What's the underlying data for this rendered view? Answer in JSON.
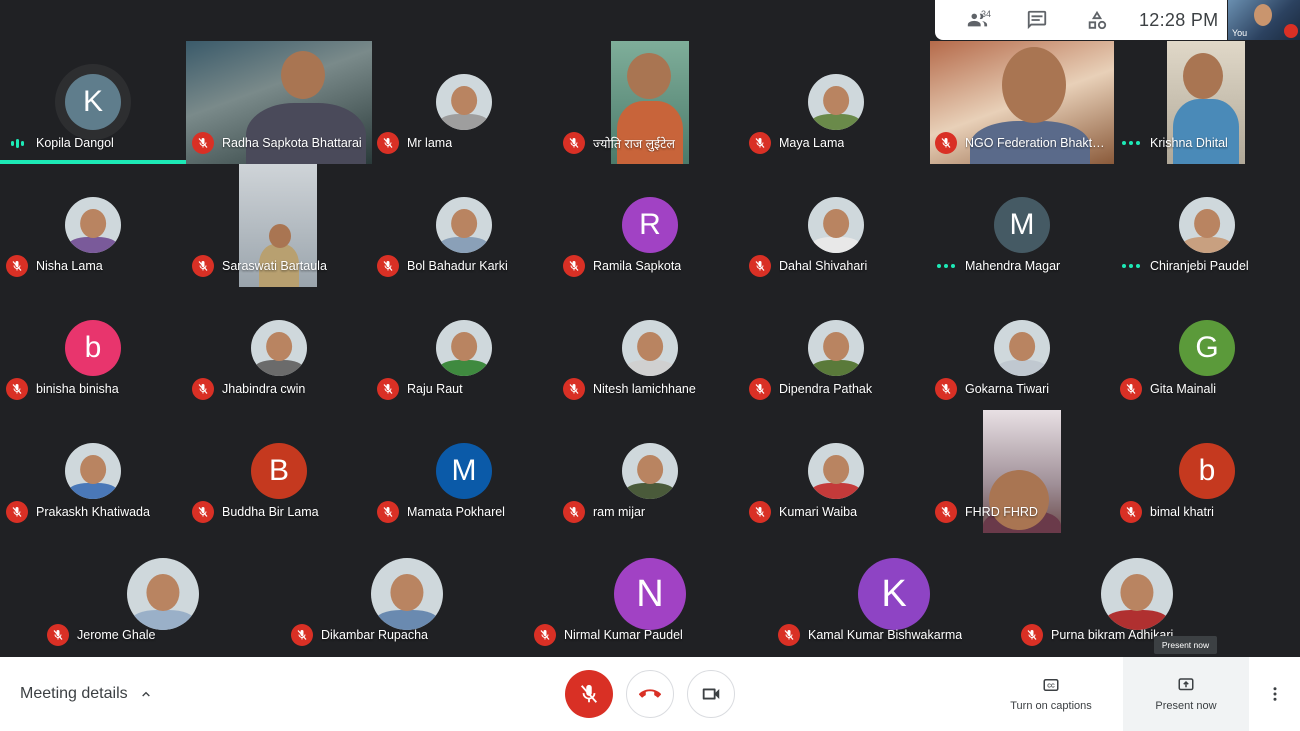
{
  "topbar": {
    "participants_count": "34",
    "time": "12:28 PM",
    "self_label": "You"
  },
  "rows": [
    [
      {
        "name": "Kopila Dangol",
        "kind": "letter",
        "letter": "K",
        "color": "#5f7d8c",
        "status": "speaking",
        "active": true
      },
      {
        "name": "Radha Sapkota Bhattarai",
        "kind": "video",
        "status": "muted"
      },
      {
        "name": "Mr lama",
        "kind": "photo",
        "color": "#9e9e9e",
        "status": "muted"
      },
      {
        "name": "ज्योति राज लुईटेल",
        "kind": "video",
        "status": "muted"
      },
      {
        "name": "Maya Lama",
        "kind": "photo",
        "color": "#6a8a4a",
        "status": "muted"
      },
      {
        "name": "NGO Federation Bhaktapur",
        "kind": "video",
        "status": "muted"
      },
      {
        "name": "Krishna Dhital",
        "kind": "video",
        "status": "dots"
      }
    ],
    [
      {
        "name": "Nisha Lama",
        "kind": "photo",
        "color": "#7a5a9a",
        "status": "muted"
      },
      {
        "name": "Saraswati Bartaula",
        "kind": "video",
        "status": "muted"
      },
      {
        "name": "Bol Bahadur Karki",
        "kind": "photo",
        "color": "#8aa0b8",
        "status": "muted"
      },
      {
        "name": "Ramila Sapkota",
        "kind": "letter",
        "letter": "R",
        "color": "#a142c4",
        "status": "muted"
      },
      {
        "name": "Dahal Shivahari",
        "kind": "photo",
        "color": "#e8e8e8",
        "status": "muted"
      },
      {
        "name": "Mahendra Magar",
        "kind": "letter",
        "letter": "M",
        "color": "#455a64",
        "status": "dots"
      },
      {
        "name": "Chiranjebi Paudel",
        "kind": "photo",
        "color": "#c8a080",
        "status": "dots"
      }
    ],
    [
      {
        "name": "binisha binisha",
        "kind": "letter",
        "letter": "b",
        "color": "#e8356d",
        "status": "muted"
      },
      {
        "name": "Jhabindra cwin",
        "kind": "photo",
        "color": "#6b6b6b",
        "status": "muted"
      },
      {
        "name": "Raju Raut",
        "kind": "photo",
        "color": "#3f8a3f",
        "status": "muted"
      },
      {
        "name": "Nitesh lamichhane",
        "kind": "photo",
        "color": "#d0d0d0",
        "status": "muted"
      },
      {
        "name": "Dipendra Pathak",
        "kind": "photo",
        "color": "#5a7a3a",
        "status": "muted"
      },
      {
        "name": "Gokarna Tiwari",
        "kind": "photo",
        "color": "#c0c8d0",
        "status": "muted"
      },
      {
        "name": "Gita Mainali",
        "kind": "letter",
        "letter": "G",
        "color": "#5b9a3a",
        "status": "muted"
      }
    ],
    [
      {
        "name": "Prakaskh Khatiwada",
        "kind": "photo",
        "color": "#4a78b8",
        "status": "muted"
      },
      {
        "name": "Buddha Bir Lama",
        "kind": "letter",
        "letter": "B",
        "color": "#c5391f",
        "status": "muted"
      },
      {
        "name": "Mamata Pokharel",
        "kind": "letter",
        "letter": "M",
        "color": "#0b5aa8",
        "status": "muted"
      },
      {
        "name": "ram mijar",
        "kind": "photo",
        "color": "#4a5a3a",
        "status": "muted"
      },
      {
        "name": "Kumari Waiba",
        "kind": "photo",
        "color": "#c43a3a",
        "status": "muted"
      },
      {
        "name": "FHRD FHRD",
        "kind": "video",
        "status": "muted"
      },
      {
        "name": "bimal khatri",
        "kind": "letter",
        "letter": "b",
        "color": "#c5391f",
        "status": "muted"
      }
    ],
    [
      {
        "name": "Jerome Ghale",
        "kind": "photo",
        "color": "#9ab0c8",
        "status": "muted"
      },
      {
        "name": "Dikambar Rupacha",
        "kind": "photo",
        "color": "#6a8ab0",
        "status": "muted"
      },
      {
        "name": "Nirmal Kumar Paudel",
        "kind": "letter",
        "letter": "N",
        "color": "#a142c4",
        "status": "muted"
      },
      {
        "name": "Kamal Kumar Bishwakarma",
        "kind": "letter",
        "letter": "K",
        "color": "#8e44c4",
        "status": "muted"
      },
      {
        "name": "Purna bikram Adhikari",
        "kind": "photo",
        "color": "#b03030",
        "status": "muted"
      }
    ]
  ],
  "tooltip": "Present now",
  "bottom": {
    "meeting_details": "Meeting details",
    "captions": "Turn on captions",
    "present": "Present now"
  }
}
